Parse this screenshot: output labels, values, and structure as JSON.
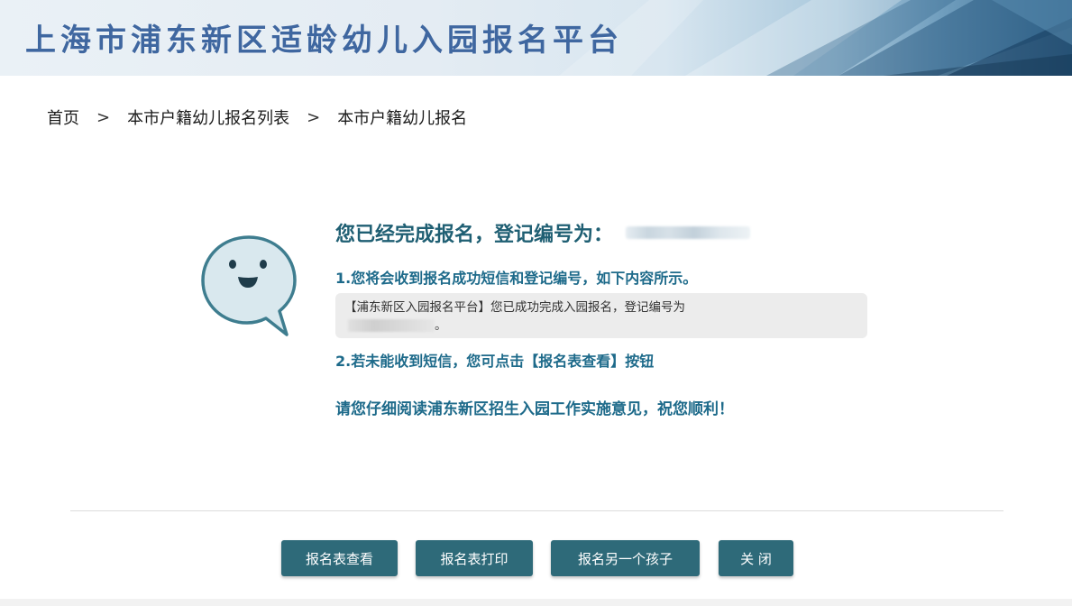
{
  "header": {
    "title": "上海市浦东新区适龄幼儿入园报名平台"
  },
  "breadcrumb": {
    "items": [
      "首页",
      "本市户籍幼儿报名列表",
      "本市户籍幼儿报名"
    ],
    "separator": ">"
  },
  "message": {
    "title": "您已经完成报名，登记编号为：",
    "line1": "1.您将会收到报名成功短信和登记编号，如下内容所示。",
    "sms_text": "【浦东新区入园报名平台】您已成功完成入园报名，登记编号为",
    "sms_end": "。",
    "line2": "2.若未能收到短信，您可点击【报名表查看】按钮",
    "line3": "请您仔细阅读浦东新区招生入园工作实施意见，祝您顺利！"
  },
  "buttons": {
    "view": "报名表查看",
    "print": "报名表打印",
    "another": "报名另一个孩子",
    "close": "关 闭"
  },
  "colors": {
    "button_bg": "#2e6a79",
    "accent_text": "#1d6a8a",
    "banner_title": "#3f67a0"
  },
  "icons": {
    "smiley": "smiley-speech-bubble-icon"
  }
}
